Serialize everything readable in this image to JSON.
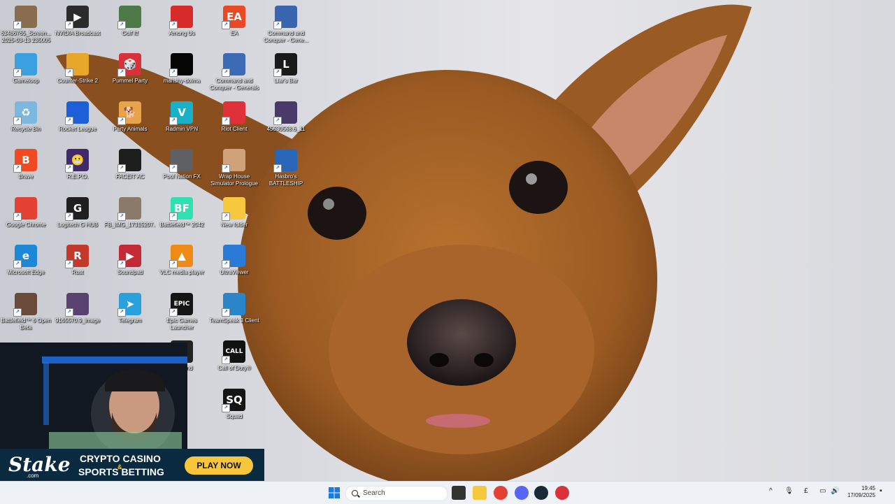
{
  "desktop": {
    "icons": [
      {
        "label": "63486765_Screen... 2025-03-13 235005",
        "glyph": "",
        "color": "#8a6d4e",
        "col": 0,
        "row": 0
      },
      {
        "label": "Gameloop",
        "glyph": "",
        "color": "#3aa0e0",
        "col": 0,
        "row": 1
      },
      {
        "label": "Recycle Bin",
        "glyph": "♻",
        "color": "#7cb7e0",
        "col": 0,
        "row": 2
      },
      {
        "label": "Brave",
        "glyph": "B",
        "color": "#f04a23",
        "col": 0,
        "row": 3
      },
      {
        "label": "Google Chrome",
        "glyph": "",
        "color": "#e34133",
        "col": 0,
        "row": 4
      },
      {
        "label": "Microsoft Edge",
        "glyph": "e",
        "color": "#1e88d8",
        "col": 0,
        "row": 5
      },
      {
        "label": "Battlefield™ 6 Open Beta",
        "glyph": "",
        "color": "#6a4a38",
        "col": 0,
        "row": 6
      },
      {
        "label": "NVIDIA Broadcast",
        "glyph": "▶",
        "color": "#2b2b2b",
        "col": 1,
        "row": 0
      },
      {
        "label": "Counter-Strike 2",
        "glyph": "",
        "color": "#e6a72b",
        "col": 1,
        "row": 1
      },
      {
        "label": "Rocket League",
        "glyph": "",
        "color": "#1c5fd8",
        "col": 1,
        "row": 2
      },
      {
        "label": "R.E.P.O.",
        "glyph": "😬",
        "color": "#3f2a6a",
        "col": 1,
        "row": 3
      },
      {
        "label": "Logitech G HUB",
        "glyph": "G",
        "color": "#1f1f1f",
        "col": 1,
        "row": 4
      },
      {
        "label": "Rust",
        "glyph": "R",
        "color": "#c43a2a",
        "col": 1,
        "row": 5
      },
      {
        "label": "9165570.9_image",
        "glyph": "",
        "color": "#5a4270",
        "col": 1,
        "row": 6
      },
      {
        "label": "Golf It!",
        "glyph": "",
        "color": "#4e7a4a",
        "col": 2,
        "row": 0
      },
      {
        "label": "Pummel Party",
        "glyph": "🎲",
        "color": "#d8313a",
        "col": 2,
        "row": 1
      },
      {
        "label": "Party Animals",
        "glyph": "🐕",
        "color": "#e8a44a",
        "col": 2,
        "row": 2
      },
      {
        "label": "FACEIT AC",
        "glyph": "",
        "color": "#1e1e1e",
        "col": 2,
        "row": 3
      },
      {
        "label": "FB_IMG_17315207...",
        "glyph": "",
        "color": "#8a7a6a",
        "col": 2,
        "row": 4
      },
      {
        "label": "Soundpad",
        "glyph": "▶",
        "color": "#c42a35",
        "col": 2,
        "row": 5
      },
      {
        "label": "Telegram",
        "glyph": "➤",
        "color": "#2aa0dc",
        "col": 2,
        "row": 6
      },
      {
        "label": "Among Us",
        "glyph": "",
        "color": "#d72b2b",
        "col": 3,
        "row": 0
      },
      {
        "label": "mahshy-dolma",
        "glyph": "",
        "color": "#050505",
        "col": 3,
        "row": 1
      },
      {
        "label": "Radmin VPN",
        "glyph": "V",
        "color": "#1ab0c8",
        "col": 3,
        "row": 2
      },
      {
        "label": "Pool Nation FX",
        "glyph": "",
        "color": "#5e6064",
        "col": 3,
        "row": 3
      },
      {
        "label": "Battlefield™ 2042",
        "glyph": "BF",
        "color": "#2fe0b0",
        "col": 3,
        "row": 4
      },
      {
        "label": "VLC media player",
        "glyph": "▲",
        "color": "#f08a16",
        "col": 3,
        "row": 5
      },
      {
        "label": "Epic Games Launcher",
        "glyph": "EPIC",
        "color": "#151515",
        "col": 3,
        "row": 6
      },
      {
        "label": "Playland",
        "glyph": "",
        "color": "#222222",
        "col": 3,
        "row": 7
      },
      {
        "label": "EA",
        "glyph": "EA",
        "color": "#ea4a22",
        "col": 4,
        "row": 0
      },
      {
        "label": "Command and Conquer - Generals",
        "glyph": "",
        "color": "#3d6ab5",
        "col": 4,
        "row": 1
      },
      {
        "label": "Riot Client",
        "glyph": "",
        "color": "#e0313a",
        "col": 4,
        "row": 2
      },
      {
        "label": "Wrap House Simulator Prologue",
        "glyph": "",
        "color": "#cfa27a",
        "col": 4,
        "row": 3
      },
      {
        "label": "New folder",
        "glyph": "",
        "color": "#f5c83e",
        "col": 4,
        "row": 4
      },
      {
        "label": "UltraViewer",
        "glyph": "",
        "color": "#2a7ad8",
        "col": 4,
        "row": 5
      },
      {
        "label": "TeamSpeak 3 Client",
        "glyph": "",
        "color": "#2a86c8",
        "col": 4,
        "row": 6
      },
      {
        "label": "Call of Duty®",
        "glyph": "CALL",
        "color": "#111111",
        "col": 4,
        "row": 7
      },
      {
        "label": "Squad",
        "glyph": "SQ",
        "color": "#151515",
        "col": 4,
        "row": 8
      },
      {
        "label": "Command and Conquer - Gene...",
        "glyph": "",
        "color": "#3a66b0",
        "col": 5,
        "row": 0
      },
      {
        "label": "Liar's Bar",
        "glyph": "L",
        "color": "#1a1a1a",
        "col": 5,
        "row": 1
      },
      {
        "label": "45630568.6_11",
        "glyph": "",
        "color": "#4a3a6a",
        "col": 5,
        "row": 2
      },
      {
        "label": "Hasbro's BATTLESHIP",
        "glyph": "",
        "color": "#2a66b8",
        "col": 5,
        "row": 3
      }
    ]
  },
  "ad": {
    "brand": "Stake",
    "brand_sub": ".com",
    "line1": "CRYPTO CASINO",
    "amp": "&",
    "line2": "SPORTS BETTING",
    "cta": "PLAY NOW"
  },
  "taskbar": {
    "search_placeholder": "Search",
    "apps": [
      {
        "name": "task-view",
        "color": "#333333"
      },
      {
        "name": "file-explorer",
        "color": "#f5c83e"
      },
      {
        "name": "chrome",
        "color": "#e34133"
      },
      {
        "name": "discord",
        "color": "#5865f2"
      },
      {
        "name": "steam",
        "color": "#1b2838"
      },
      {
        "name": "recording-app",
        "color": "#d8313a"
      }
    ],
    "tray": {
      "chevron": "^",
      "lang": "£",
      "time": "19:45",
      "date": "17/09/2025"
    }
  }
}
